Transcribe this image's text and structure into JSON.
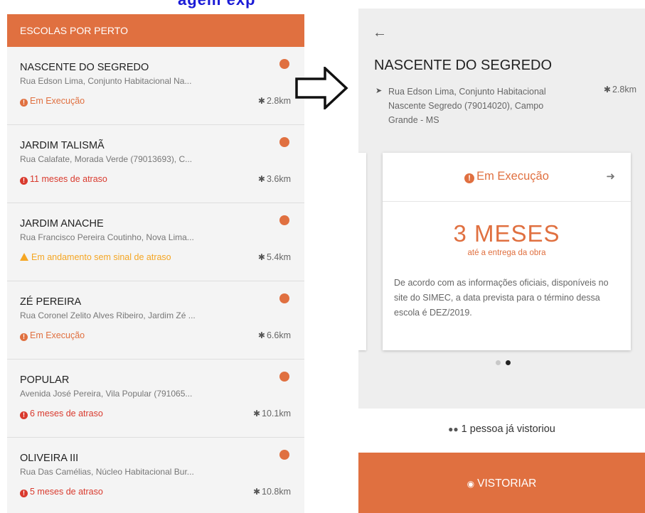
{
  "top_crop_text": "agem exp",
  "colors": {
    "accent": "#e07040",
    "status_em_execucao": "#e07040",
    "status_atraso": "#d93a2e",
    "status_andamento": "#f5a623"
  },
  "left_screen": {
    "header": "ESCOLAS POR PERTO",
    "schools": [
      {
        "name": "NASCENTE DO SEGREDO",
        "address": "Rua Edson Lima, Conjunto Habitacional Na...",
        "status": "Em Execução",
        "status_type": "execucao",
        "distance": "2.8km"
      },
      {
        "name": "JARDIM TALISMÃ",
        "address": "Rua Calafate, Morada Verde (79013693), C...",
        "status": "11 meses de atraso",
        "status_type": "atraso",
        "distance": "3.6km"
      },
      {
        "name": "JARDIM ANACHE",
        "address": "Rua Francisco Pereira Coutinho, Nova Lima...",
        "status": "Em andamento sem sinal de atraso",
        "status_type": "andamento",
        "distance": "5.4km"
      },
      {
        "name": "ZÉ PEREIRA",
        "address": "Rua Coronel Zelito Alves Ribeiro, Jardim Zé ...",
        "status": "Em Execução",
        "status_type": "execucao",
        "distance": "6.6km"
      },
      {
        "name": "POPULAR",
        "address": "Avenida José Pereira, Vila Popular (791065...",
        "status": "6 meses de atraso",
        "status_type": "atraso",
        "distance": "10.1km"
      },
      {
        "name": "OLIVEIRA III",
        "address": "Rua Das Camélias, Núcleo Habitacional Bur...",
        "status": "5 meses de atraso",
        "status_type": "atraso",
        "distance": "10.8km"
      }
    ]
  },
  "right_screen": {
    "back_icon": "arrow-left-icon",
    "title": "NASCENTE DO SEGREDO",
    "address": "Rua Edson Lima, Conjunto Habitacional Nascente Segredo (79014020), Campo Grande - MS",
    "distance": "2.8km",
    "card": {
      "status": "Em Execução",
      "months": "3 MESES",
      "months_caption": "até a entrega da obra",
      "description": "De acordo com as informações oficiais, disponíveis no site do SIMEC, a data prevista para o término dessa escola é DEZ/2019."
    },
    "pager": {
      "count": 2,
      "active_index": 1
    },
    "visitors": "1 pessoa já vistoriou",
    "button_label": "VISTORIAR"
  }
}
